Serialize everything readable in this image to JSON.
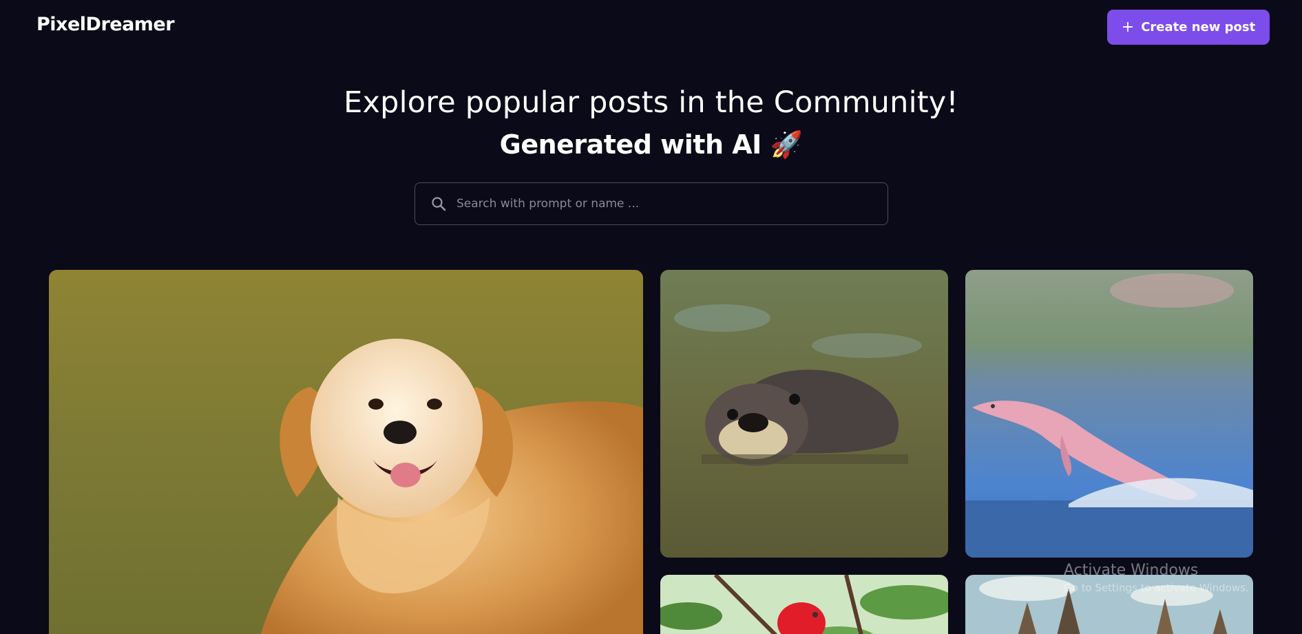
{
  "header": {
    "brand": "PixelDreamer",
    "create_button_label": "Create new post",
    "create_button_icon": "plus-icon"
  },
  "hero": {
    "title": "Explore popular posts in the Community!",
    "subtitle": "Generated with AI 🚀"
  },
  "search": {
    "placeholder": "Search with prompt or name ...",
    "value": "",
    "icon": "search-icon"
  },
  "gallery": {
    "posts": [
      {
        "subject": "golden retriever in grass field"
      },
      {
        "subject": "otter swimming in water"
      },
      {
        "subject": "pink dolphin jumping from ocean"
      },
      {
        "subject": "red bird on green branches"
      },
      {
        "subject": "castle towers under blue sky"
      }
    ]
  },
  "watermark": {
    "title": "Activate Windows",
    "subtitle": "Go to Settings to activate Windows."
  },
  "colors": {
    "background": "#0b0a19",
    "accent": "#7c4dea",
    "search_border": "#4d4c5c",
    "placeholder": "#8a8996"
  }
}
